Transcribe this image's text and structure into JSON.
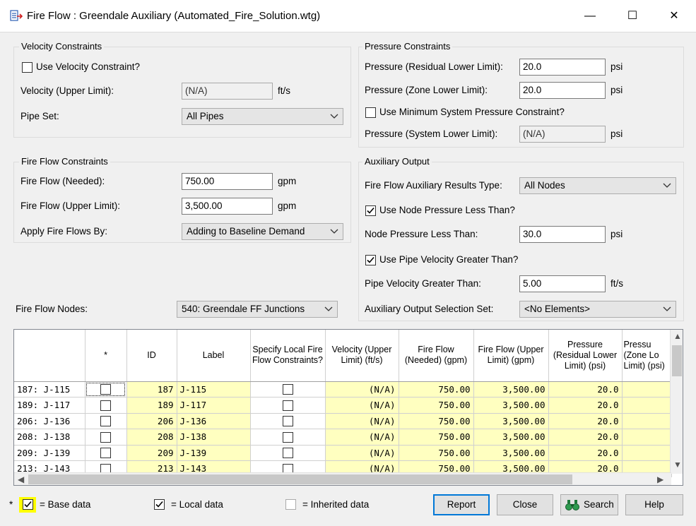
{
  "window": {
    "title": "Fire Flow : Greendale Auxiliary (Automated_Fire_Solution.wtg)",
    "minimize": "—",
    "maximize": "☐",
    "close": "✕"
  },
  "velocity_constraints": {
    "title": "Velocity Constraints",
    "use_label": "Use Velocity Constraint?",
    "use_checked": false,
    "velocity_label": "Velocity (Upper Limit):",
    "velocity_value": "(N/A)",
    "velocity_unit": "ft/s",
    "pipe_set_label": "Pipe Set:",
    "pipe_set_value": "All Pipes"
  },
  "pressure_constraints": {
    "title": "Pressure Constraints",
    "residual_label": "Pressure (Residual Lower Limit):",
    "residual_value": "20.0",
    "residual_unit": "psi",
    "zone_label": "Pressure (Zone Lower Limit):",
    "zone_value": "20.0",
    "zone_unit": "psi",
    "use_min_label": "Use Minimum System Pressure Constraint?",
    "use_min_checked": false,
    "system_label": "Pressure (System Lower Limit):",
    "system_value": "(N/A)",
    "system_unit": "psi"
  },
  "fire_flow_constraints": {
    "title": "Fire Flow Constraints",
    "needed_label": "Fire Flow (Needed):",
    "needed_value": "750.00",
    "needed_unit": "gpm",
    "upper_label": "Fire Flow (Upper Limit):",
    "upper_value": "3,500.00",
    "upper_unit": "gpm",
    "apply_label": "Apply Fire Flows By:",
    "apply_value": "Adding to Baseline Demand"
  },
  "auxiliary_output": {
    "title": "Auxiliary Output",
    "results_type_label": "Fire Flow Auxiliary Results Type:",
    "results_type_value": "All Nodes",
    "use_node_label": "Use Node Pressure Less Than?",
    "use_node_checked": true,
    "node_label": "Node Pressure Less Than:",
    "node_value": "30.0",
    "node_unit": "psi",
    "use_pipe_label": "Use Pipe Velocity Greater Than?",
    "use_pipe_checked": true,
    "pipe_label": "Pipe Velocity Greater Than:",
    "pipe_value": "5.00",
    "pipe_unit": "ft/s",
    "selection_label": "Auxiliary Output Selection Set:",
    "selection_value": "<No Elements>"
  },
  "fire_flow_nodes": {
    "label": "Fire Flow Nodes:",
    "value": "540: Greendale FF Junctions"
  },
  "table": {
    "columns": [
      "",
      "*",
      "ID",
      "Label",
      "Specify Local Fire Flow Constraints?",
      "Velocity (Upper Limit) (ft/s)",
      "Fire Flow (Needed) (gpm)",
      "Fire Flow (Upper Limit) (gpm)",
      "Pressure (Residual Lower Limit) (psi)",
      "Pressu (Zone Lo Limit) (psi)"
    ],
    "rows": [
      {
        "row": "187: J-115",
        "id": "187",
        "label": "J-115",
        "velocity": "(N/A)",
        "needed": "750.00",
        "upper": "3,500.00",
        "residual": "20.0"
      },
      {
        "row": "189: J-117",
        "id": "189",
        "label": "J-117",
        "velocity": "(N/A)",
        "needed": "750.00",
        "upper": "3,500.00",
        "residual": "20.0"
      },
      {
        "row": "206: J-136",
        "id": "206",
        "label": "J-136",
        "velocity": "(N/A)",
        "needed": "750.00",
        "upper": "3,500.00",
        "residual": "20.0"
      },
      {
        "row": "208: J-138",
        "id": "208",
        "label": "J-138",
        "velocity": "(N/A)",
        "needed": "750.00",
        "upper": "3,500.00",
        "residual": "20.0"
      },
      {
        "row": "209: J-139",
        "id": "209",
        "label": "J-139",
        "velocity": "(N/A)",
        "needed": "750.00",
        "upper": "3,500.00",
        "residual": "20.0"
      },
      {
        "row": "213: J-143",
        "id": "213",
        "label": "J-143",
        "velocity": "(N/A)",
        "needed": "750.00",
        "upper": "3,500.00",
        "residual": "20.0"
      }
    ]
  },
  "legend": {
    "star": "*",
    "base": "= Base data",
    "local": "= Local data",
    "inherited": "= Inherited data"
  },
  "buttons": {
    "report": "Report",
    "close": "Close",
    "search": "Search",
    "help": "Help"
  },
  "icons": {
    "app": "fire-flow-app-icon",
    "search": "binoculars-icon"
  },
  "colors": {
    "cell_yellow": "#ffffc0",
    "legend_highlight": "#ffff00",
    "default_button_border": "#0078d7"
  }
}
